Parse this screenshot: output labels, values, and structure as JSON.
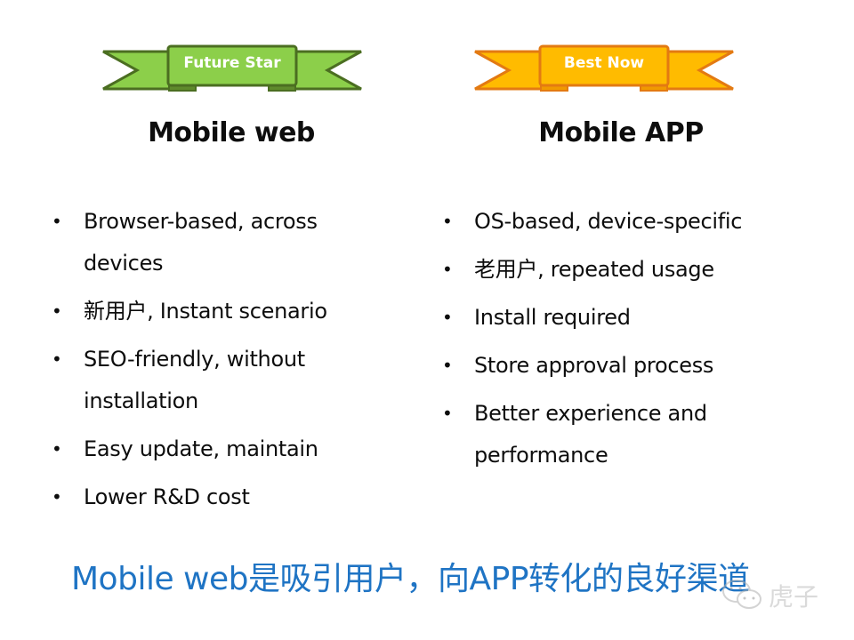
{
  "colors": {
    "green_fill": "#8ccf4a",
    "green_stroke": "#4b6e21",
    "orange_fill": "#ffbb00",
    "orange_stroke": "#e37a12",
    "footer_text": "#1f74c4"
  },
  "left": {
    "ribbon_label": "Future Star",
    "title": "Mobile web",
    "bullets": [
      "Browser-based, across devices",
      "新用户, Instant scenario",
      "SEO-friendly, without installation",
      "Easy update, maintain",
      "Lower R&D cost"
    ]
  },
  "right": {
    "ribbon_label": "Best Now",
    "title": "Mobile APP",
    "bullets": [
      "OS-based, device-specific",
      "老用户, repeated usage",
      "Install required",
      "Store approval process",
      "Better experience and performance"
    ]
  },
  "footer": {
    "text": "Mobile web是吸引用户，向APP转化的良好渠道"
  },
  "watermark": {
    "icon": "wechat-icon",
    "text": "虎子"
  }
}
